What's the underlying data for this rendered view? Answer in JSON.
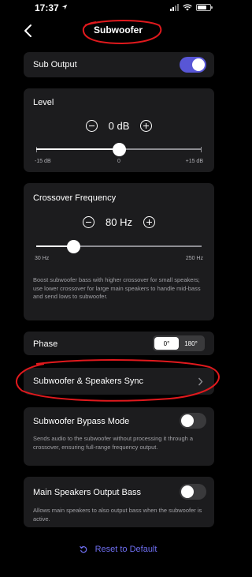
{
  "status": {
    "time": "17:37"
  },
  "header": {
    "title": "Subwoofer"
  },
  "sub_output": {
    "label": "Sub Output",
    "enabled": true
  },
  "level": {
    "label": "Level",
    "value": "0 dB",
    "min_label": "-15 dB",
    "mid_label": "0",
    "max_label": "+15 dB",
    "min": -15,
    "max": 15,
    "current": 0
  },
  "crossover": {
    "label": "Crossover Frequency",
    "value": "80 Hz",
    "min_label": "30 Hz",
    "max_label": "250 Hz",
    "min": 30,
    "max": 250,
    "current": 80,
    "description": "Boost subwoofer bass with higher crossover for small speakers; use lower crossover for large main speakers to handle mid-bass and send lows to subwoofer."
  },
  "phase": {
    "label": "Phase",
    "options": [
      "0°",
      "180°"
    ],
    "selected": "0°"
  },
  "sync": {
    "label": "Subwoofer & Speakers Sync"
  },
  "bypass": {
    "label": "Subwoofer Bypass Mode",
    "enabled": false,
    "description": "Sends audio to the subwoofer without processing it through a crossover, ensuring full-range frequency output."
  },
  "main_bass": {
    "label": "Main Speakers Output Bass",
    "enabled": false,
    "description": "Allows main speakers to also output bass when the subwoofer is active."
  },
  "reset": {
    "label": "Reset to Default"
  },
  "colors": {
    "accent": "#5856d6",
    "annotation": "#e0191d",
    "card": "#1c1c1e",
    "link": "#6e6ef0"
  }
}
